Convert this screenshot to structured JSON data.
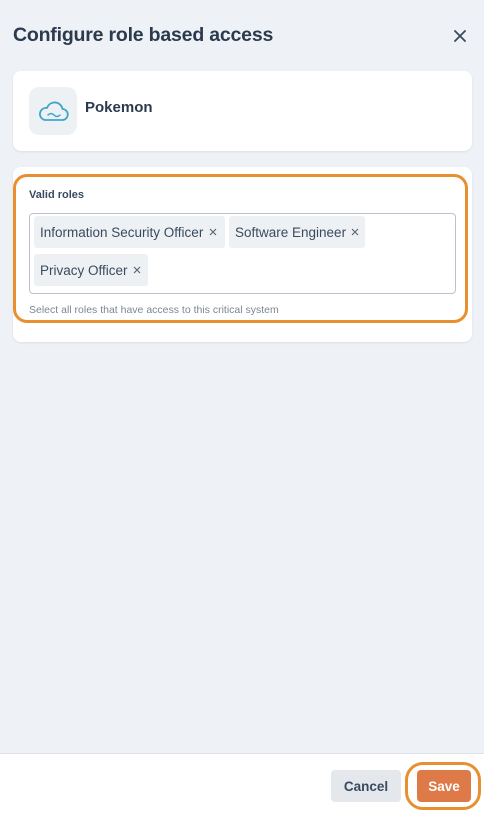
{
  "header": {
    "title": "Configure role based access",
    "close_icon": "close-icon"
  },
  "system": {
    "icon": "cloud-icon",
    "name": "Pokemon"
  },
  "roles": {
    "label": "Valid roles",
    "selected": [
      "Information Security Officer",
      "Software Engineer",
      "Privacy Officer"
    ],
    "help_text": "Select all roles that have access to this critical system"
  },
  "footer": {
    "cancel_label": "Cancel",
    "save_label": "Save"
  },
  "colors": {
    "highlight": "#e8902f",
    "save_button": "#dd7a48",
    "cloud_icon": "#3fa6c9",
    "background": "#eef1f5"
  }
}
